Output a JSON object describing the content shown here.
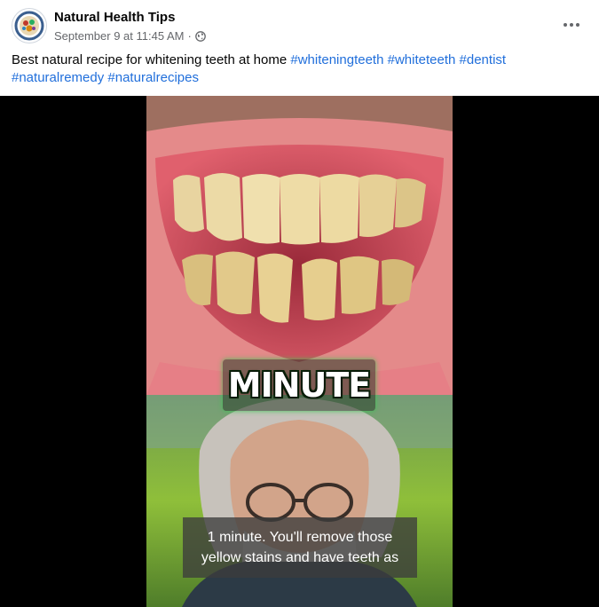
{
  "post": {
    "author": "Natural Health Tips",
    "timestamp": "September 9 at 11:45 AM",
    "separator": "·",
    "privacy_icon": "globe-icon",
    "more_icon": "more-options-icon",
    "caption_text": "Best natural recipe for whitening teeth at home ",
    "hashtags": [
      "#whiteningteeth",
      "#whiteteeth",
      "#dentist",
      "#naturalremedy",
      "#naturalrecipes"
    ]
  },
  "video": {
    "overlay_word": "MINUTE",
    "subtitle_line1": "1 minute. You'll remove those",
    "subtitle_line2": "yellow stains and have teeth as"
  },
  "colors": {
    "hashtag": "#216fdb",
    "author": "#050505",
    "meta": "#65676b",
    "video_bg": "#000000"
  }
}
